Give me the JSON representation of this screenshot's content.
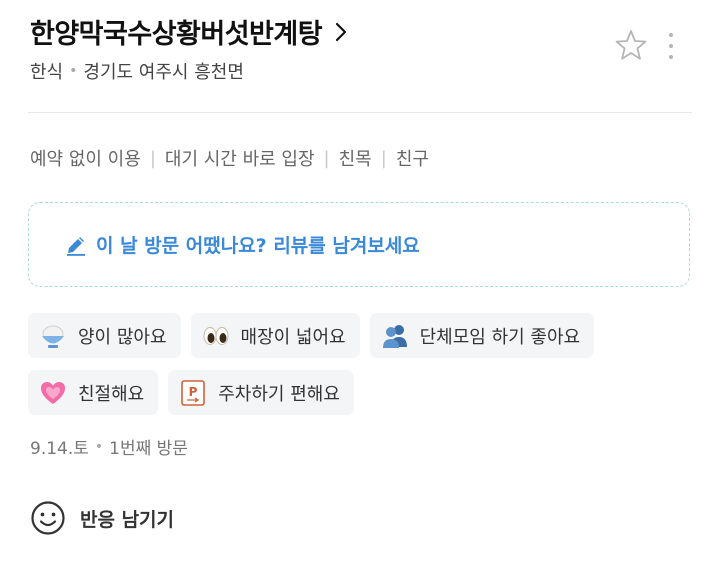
{
  "place": {
    "name": "한양막국수상황버섯반계탕",
    "category": "한식",
    "location": "경기도 여주시 흥천면"
  },
  "features": [
    "예약 없이 이용",
    "대기 시간 바로 입장",
    "친목",
    "친구"
  ],
  "review_prompt": "이 날 방문 어땠나요? 리뷰를 남겨보세요",
  "keywords": [
    {
      "label": "양이 많아요",
      "icon": "rice-bowl-icon"
    },
    {
      "label": "매장이 넓어요",
      "icon": "eyes-icon"
    },
    {
      "label": "단체모임 하기 좋아요",
      "icon": "people-icon"
    },
    {
      "label": "친절해요",
      "icon": "heart-icon"
    },
    {
      "label": "주차하기 편해요",
      "icon": "parking-icon"
    }
  ],
  "visit": {
    "date": "9.14.토",
    "count": "1번째 방문"
  },
  "reaction_label": "반응 남기기",
  "colors": {
    "accent_blue": "#3a89d8",
    "dashed_border": "#aadbd9",
    "chip_bg": "#f4f5f7"
  }
}
